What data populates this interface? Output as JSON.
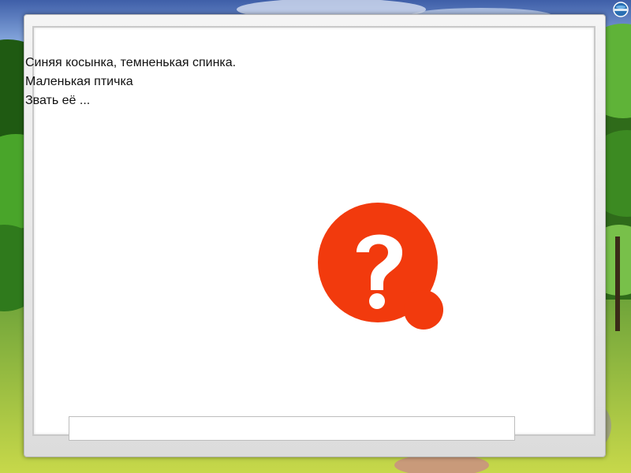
{
  "slide": {
    "riddle_lines": [
      "Синяя косынка, темненькая спинка.",
      "Маленькая птичка",
      "Звать её ..."
    ],
    "answer": "",
    "question_icon": "question-mark-icon",
    "question_color": "#f23a0d",
    "corner_icon": "navigation-globe-icon"
  }
}
